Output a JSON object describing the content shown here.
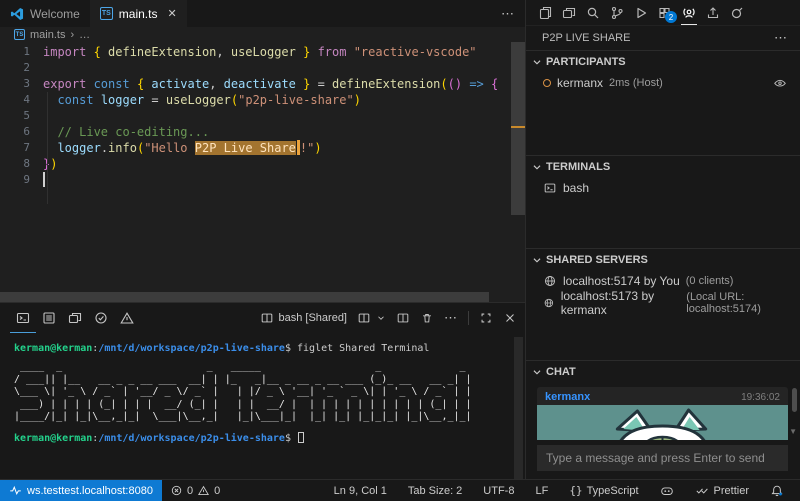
{
  "colors": {
    "background": "#1f1f1f",
    "chrome": "#181818",
    "accent_blue": "#0078d4",
    "remote_cursor_orange": "#eba33c",
    "selection_tan": "#a3742f",
    "participant_ring_orange": "#d89145",
    "terminal_green": "#23d18b",
    "terminal_blue": "#3b8eea",
    "chat_username_blue": "#3794ff",
    "chat_image_teal": "#5e918d"
  },
  "icons": {
    "more": "⋯",
    "close": "✕",
    "breadcrumb_sep": "›",
    "breadcrumb_more": "…",
    "scroll_down_arrow": "▼"
  },
  "tabbar": {
    "tabs": [
      {
        "label": "Welcome"
      },
      {
        "label": "main.ts",
        "active": true
      }
    ],
    "ts_badge": "TS"
  },
  "breadcrumb": {
    "file": "main.ts"
  },
  "editor": {
    "lines": [
      {
        "num": "1",
        "tokens": [
          [
            "kw",
            "import "
          ],
          [
            "b1",
            "{ "
          ],
          [
            "fn",
            "defineExtension"
          ],
          [
            "tx",
            ", "
          ],
          [
            "fn",
            "useLogger"
          ],
          [
            "b1",
            " } "
          ],
          [
            "kw",
            "from "
          ],
          [
            "st",
            "\"reactive-vscode\""
          ]
        ]
      },
      {
        "num": "2",
        "tokens": []
      },
      {
        "num": "3",
        "tokens": [
          [
            "kw",
            "export "
          ],
          [
            "kwb",
            "const "
          ],
          [
            "b1",
            "{ "
          ],
          [
            "vr",
            "activate"
          ],
          [
            "tx",
            ", "
          ],
          [
            "vr",
            "deactivate"
          ],
          [
            "b1",
            " } "
          ],
          [
            "tx",
            "= "
          ],
          [
            "fn",
            "defineExtension"
          ],
          [
            "b1",
            "("
          ],
          [
            "b2",
            "()"
          ],
          [
            "kwb",
            " => "
          ],
          [
            "b2",
            "{"
          ]
        ]
      },
      {
        "num": "4",
        "tokens": [
          [
            "tx",
            "  "
          ],
          [
            "kwb",
            "const "
          ],
          [
            "vr",
            "logger"
          ],
          [
            "tx",
            " = "
          ],
          [
            "fn",
            "useLogger"
          ],
          [
            "b1",
            "("
          ],
          [
            "st",
            "\"p2p-live-share\""
          ],
          [
            "b1",
            ")"
          ]
        ]
      },
      {
        "num": "5",
        "tokens": []
      },
      {
        "num": "6",
        "tokens": [
          [
            "tx",
            "  "
          ],
          [
            "cm",
            "// Live co-editing..."
          ]
        ]
      },
      {
        "num": "7",
        "tokens": [
          [
            "tx",
            "  "
          ],
          [
            "vr",
            "logger"
          ],
          [
            "tx",
            "."
          ],
          [
            "fn",
            "info"
          ],
          [
            "b1",
            "("
          ],
          [
            "st",
            "\"Hello "
          ],
          [
            "sel",
            "P2P Live Share"
          ],
          [
            "rc",
            ""
          ],
          [
            "st",
            "!\""
          ],
          [
            "b1",
            ")"
          ]
        ]
      },
      {
        "num": "8",
        "tokens": [
          [
            "b2",
            "}"
          ],
          [
            "b1",
            ")"
          ]
        ]
      },
      {
        "num": "9",
        "tokens": [
          [
            "caret",
            ""
          ]
        ]
      }
    ]
  },
  "panel": {
    "terminal_tab": "bash [Shared]",
    "prompt_user": "kerman@kerman",
    "prompt_sep": ":",
    "prompt_path": "/mnt/d/workspace/p2p-live-share",
    "prompt_cmd": "$ figlet Shared Terminal",
    "prompt2_cmd": "$ ",
    "figlet": " ____  _                        _   _____                   _             _ \n/ ___|| |__   __ _ _ __ ___  __| | |_   _|__ _ __ _ __ ___ (_)_ __   __ _| |\n\\___ \\| '_ \\ / _` | '__/ _ \\/ _` |   | |/ _ \\ '__| '_ ` _ \\| | '_ \\ / _` | |\n ___) | | | | (_| | | |  __/ (_| |   | |  __/ |  | | | | | | | | | | (_| | |\n|____/|_| |_|\\__,_|_|  \\___|\\__,_|   |_|\\___|_|  |_| |_| |_|_|_| |_|\\__,_|_|"
  },
  "sidebar": {
    "panel_title": "P2P LIVE SHARE",
    "participants": {
      "title": "PARTICIPANTS",
      "user": "kermanx",
      "meta": "2ms (Host)"
    },
    "terminals": {
      "title": "TERMINALS",
      "item": "bash"
    },
    "servers": {
      "title": "SHARED SERVERS",
      "rows": [
        {
          "label": "localhost:5174 by You",
          "meta": "(0 clients)"
        },
        {
          "label": "localhost:5173 by kermanx",
          "meta": "(Local URL: localhost:5174)"
        }
      ]
    },
    "chat": {
      "title": "CHAT",
      "message": {
        "author": "kermanx",
        "time": "19:36:02"
      },
      "input_placeholder": "Type a message and press Enter to send"
    },
    "extensions_badge": "2"
  },
  "statusbar": {
    "remote": "ws.testtest.localhost:8080",
    "errors": "0",
    "warnings": "0",
    "cursor": "Ln 9, Col 1",
    "tabsize": "Tab Size: 2",
    "encoding": "UTF-8",
    "eol": "LF",
    "language": "TypeScript",
    "formatter": "Prettier"
  }
}
